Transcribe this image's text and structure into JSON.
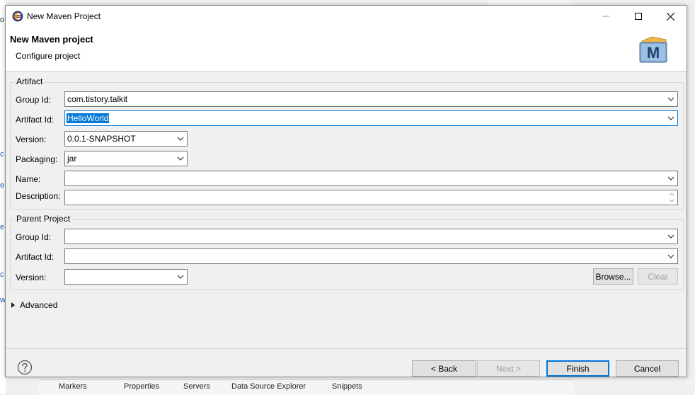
{
  "window": {
    "title": "New Maven Project"
  },
  "banner": {
    "heading": "New Maven project",
    "subtitle": "Configure project",
    "logo_letter": "M"
  },
  "artifact": {
    "legend": "Artifact",
    "group_id_label": "Group Id:",
    "group_id_value": "com.tistory.talkit",
    "artifact_id_label": "Artifact Id:",
    "artifact_id_value": "HelloWorld",
    "version_label": "Version:",
    "version_value": "0.0.1-SNAPSHOT",
    "packaging_label": "Packaging:",
    "packaging_value": "jar",
    "name_label": "Name:",
    "name_value": "",
    "description_label": "Description:",
    "description_value": ""
  },
  "parent": {
    "legend": "Parent Project",
    "group_id_label": "Group Id:",
    "group_id_value": "",
    "artifact_id_label": "Artifact Id:",
    "artifact_id_value": "",
    "version_label": "Version:",
    "version_value": "",
    "browse_label": "Browse...",
    "clear_label": "Clear"
  },
  "advanced": {
    "label": "Advanced"
  },
  "buttons": {
    "back": "< Back",
    "next": "Next >",
    "finish": "Finish",
    "cancel": "Cancel"
  },
  "background": {
    "tabs": [
      "Markers",
      "Properties",
      "Servers",
      "Data Source Explorer",
      "Snippets"
    ]
  },
  "colors": {
    "selection": "#0078d7",
    "dialog_bg": "#f0f0f0",
    "banner_bg": "#ffffff"
  }
}
